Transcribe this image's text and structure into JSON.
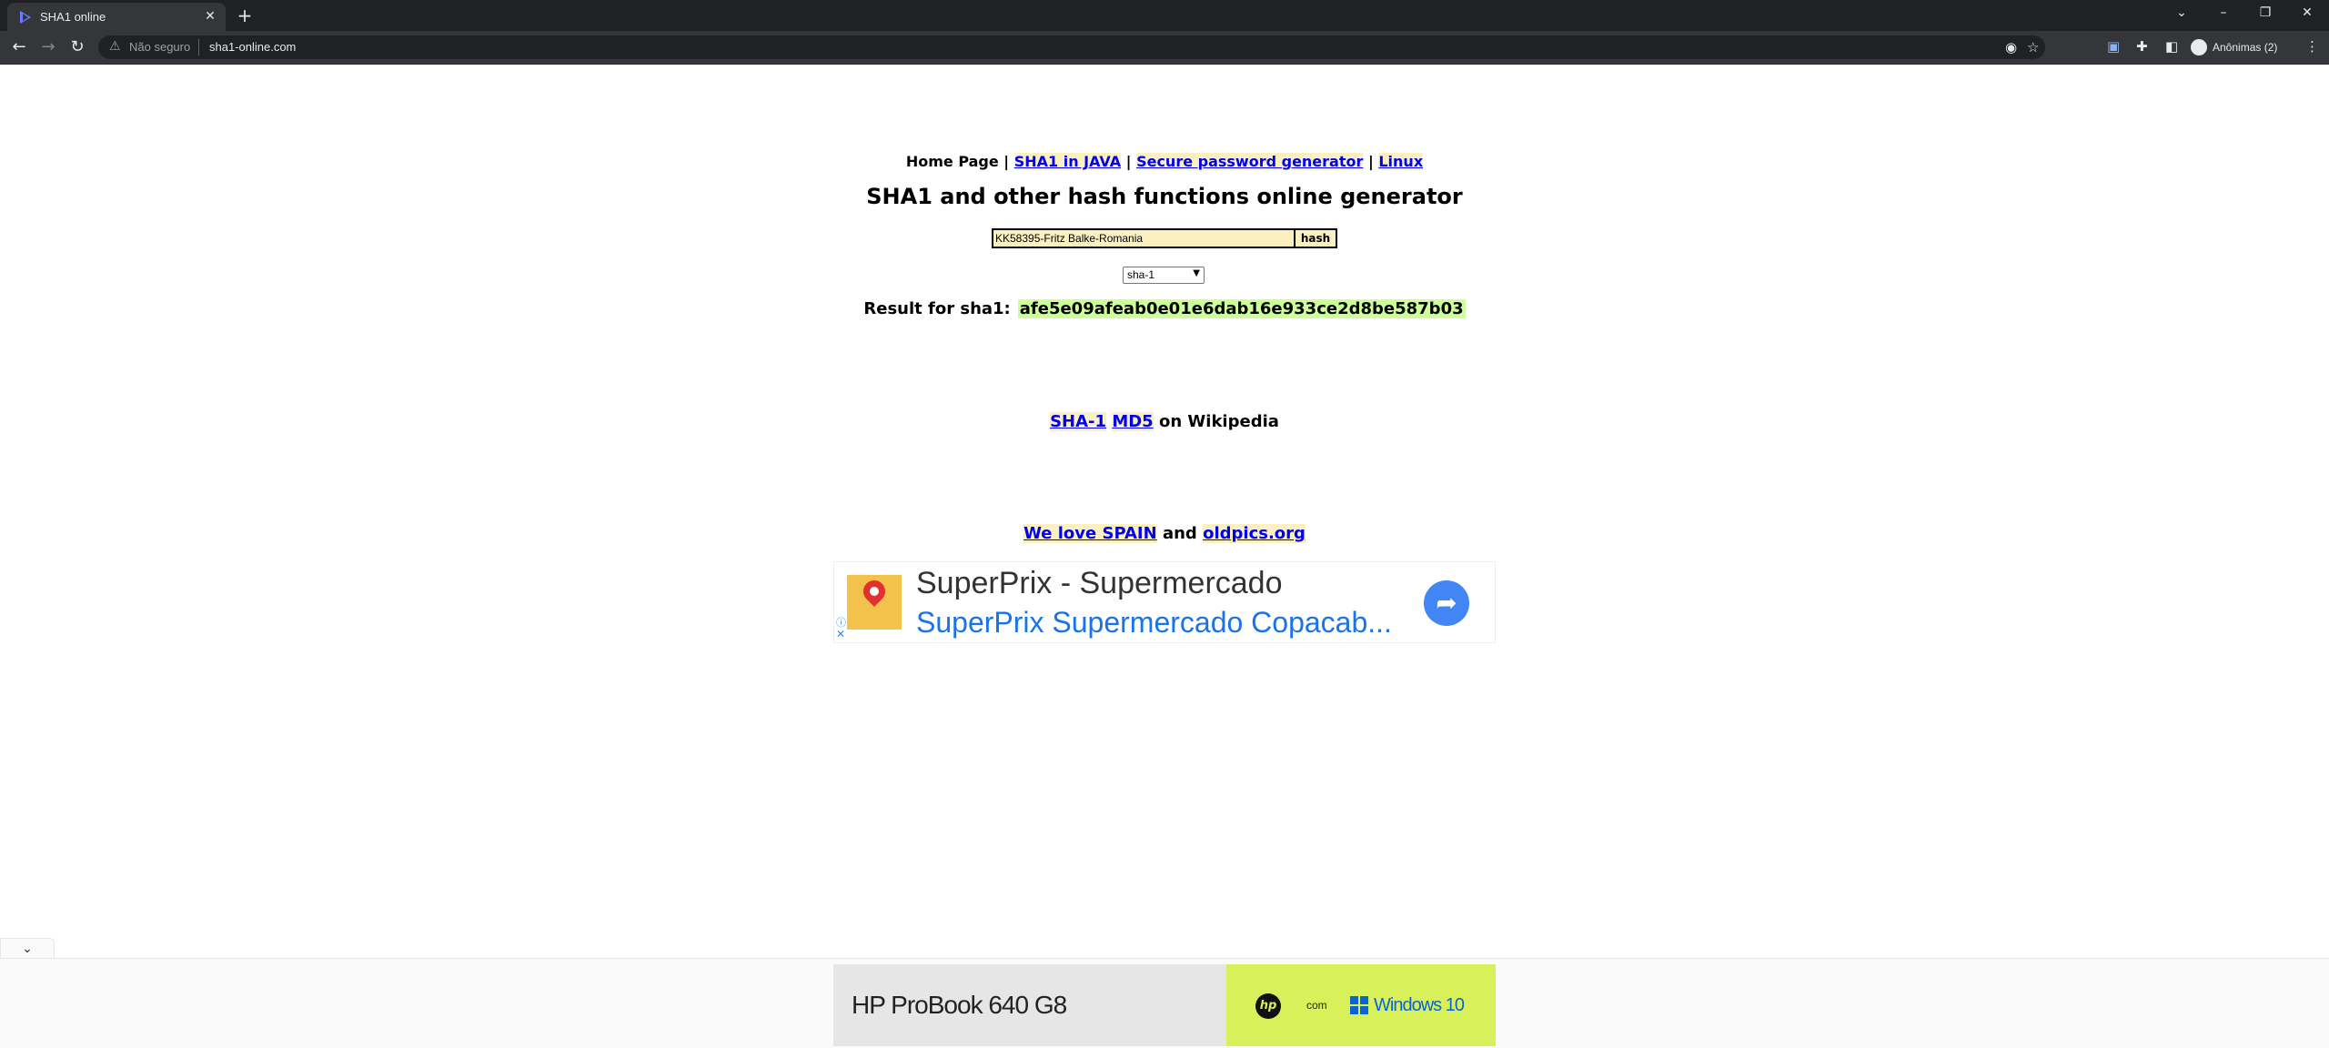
{
  "browser": {
    "tab_title": "SHA1 online",
    "new_tab": "+",
    "address": {
      "security_label": "Não seguro",
      "url": "sha1-online.com"
    },
    "profile_label": "Anônimas (2)"
  },
  "page": {
    "nav": {
      "home": "Home Page",
      "sep": " | ",
      "links": [
        "SHA1 in JAVA",
        "Secure password generator",
        "Linux"
      ]
    },
    "title": "SHA1 and other hash functions online generator",
    "form": {
      "input_value": "KK58395-Fritz Balke-Romania",
      "hash_button": "hash",
      "algorithm": "sha-1"
    },
    "result": {
      "label": "Result for sha1:",
      "hash": "afe5e09afeab0e01e6dab16e933ce2d8be587b03"
    },
    "wiki": {
      "link1": "SHA-1",
      "link2": "MD5",
      "suffix": " on Wikipedia"
    },
    "love": {
      "link1": "We love SPAIN",
      "middle": " and ",
      "link2": "oldpics.org"
    }
  },
  "ad": {
    "headline": "SuperPrix - Supermercado",
    "subline": "SuperPrix Supermercado Copacab...",
    "info_icon": "info-icon",
    "close_icon": "close-icon"
  },
  "bottom_banner": {
    "product": "HP ProBook 640 G8",
    "hp_logo": "hp",
    "com": "com",
    "windows": "Windows 10"
  },
  "colors": {
    "link": "#0000ee",
    "link_bg": "#fbf0c0",
    "hash_bg": "#ccff99",
    "ad_link": "#1a73e8",
    "banner_green": "#d8f15a"
  }
}
